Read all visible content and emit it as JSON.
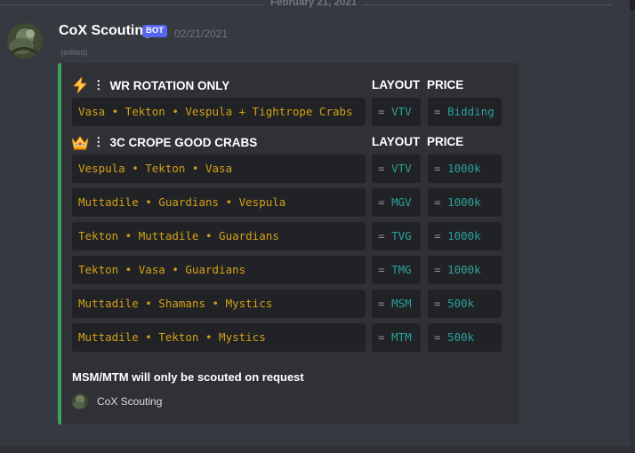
{
  "date_divider": "February 21, 2021",
  "message": {
    "author": "CoX Scouting",
    "bot_tag": "BOT",
    "timestamp": "02/21/2021",
    "edited": "(edited)"
  },
  "embed": {
    "accent_color": "#3ba55d",
    "sections": [
      {
        "icon": "lightning-icon",
        "separator": "⋮",
        "title": "WR ROTATION ONLY",
        "layout_header": "LAYOUT",
        "price_header": "PRICE",
        "rows": [
          {
            "name": "Vasa • Tekton • Vespula + Tightrope Crabs",
            "eq1": "=",
            "layout": "VTV",
            "eq2": "=",
            "price": "Bidding"
          }
        ]
      },
      {
        "icon": "crown-icon",
        "separator": "⋮",
        "title": "3C CROPE GOOD CRABS",
        "layout_header": "LAYOUT",
        "price_header": "PRICE",
        "rows": [
          {
            "name": "Vespula • Tekton • Vasa",
            "eq1": "=",
            "layout": "VTV",
            "eq2": "=",
            "price": "1000k"
          },
          {
            "name": "Muttadile • Guardians • Vespula",
            "eq1": "=",
            "layout": "MGV",
            "eq2": "=",
            "price": "1000k"
          },
          {
            "name": "Tekton • Muttadile • Guardians",
            "eq1": "=",
            "layout": "TVG",
            "eq2": "=",
            "price": "1000k"
          },
          {
            "name": "Tekton • Vasa • Guardians",
            "eq1": "=",
            "layout": "TMG",
            "eq2": "=",
            "price": "1000k"
          },
          {
            "name": "Muttadile • Shamans • Mystics",
            "eq1": "=",
            "layout": "MSM",
            "eq2": "=",
            "price": "500k"
          },
          {
            "name": "Muttadile • Tekton • Mystics",
            "eq1": "=",
            "layout": "MTM",
            "eq2": "=",
            "price": "500k"
          }
        ]
      }
    ],
    "footnote": "MSM/MTM will only be scouted on request",
    "footer_text": "CoX Scouting"
  }
}
